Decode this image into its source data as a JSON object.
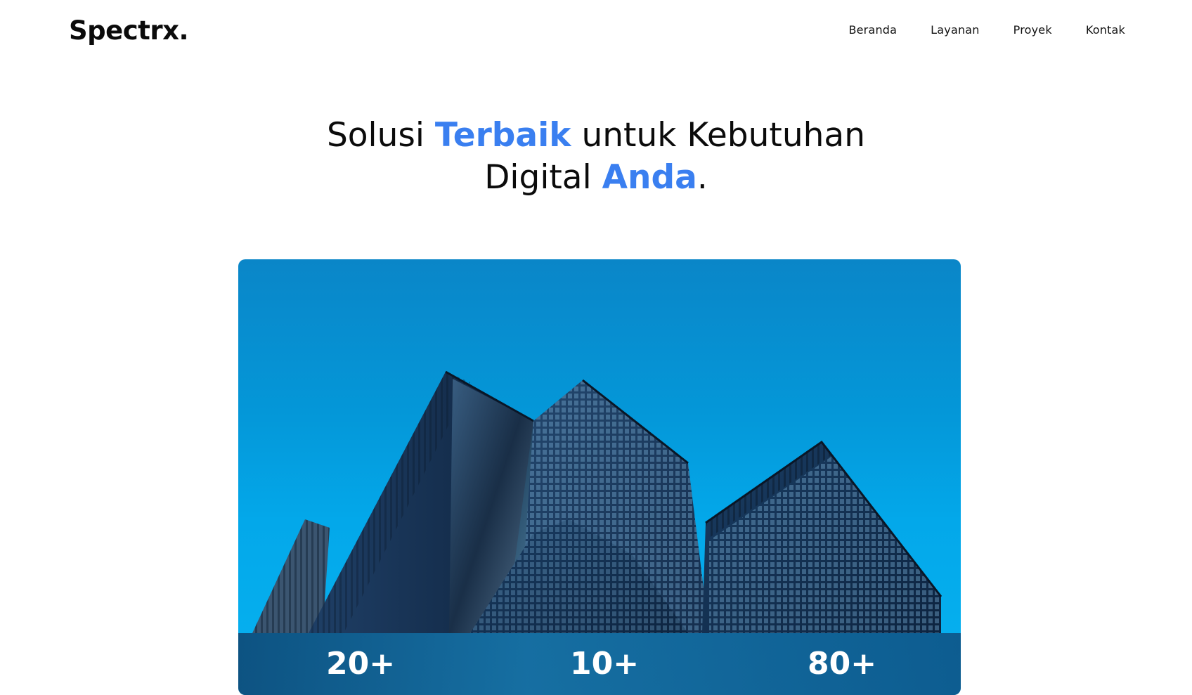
{
  "brand": {
    "logo": "Spectrx."
  },
  "nav": {
    "items": [
      {
        "label": "Beranda"
      },
      {
        "label": "Layanan"
      },
      {
        "label": "Proyek"
      },
      {
        "label": "Kontak"
      }
    ]
  },
  "hero": {
    "title_part1": "Solusi ",
    "title_accent1": "Terbaik",
    "title_part2": " untuk Kebutuhan",
    "title_part3": "Digital ",
    "title_accent2": "Anda",
    "title_part4": ".",
    "accent_color": "#3a7ff0"
  },
  "stats": [
    {
      "value": "20+"
    },
    {
      "value": "10+"
    },
    {
      "value": "80+"
    }
  ]
}
